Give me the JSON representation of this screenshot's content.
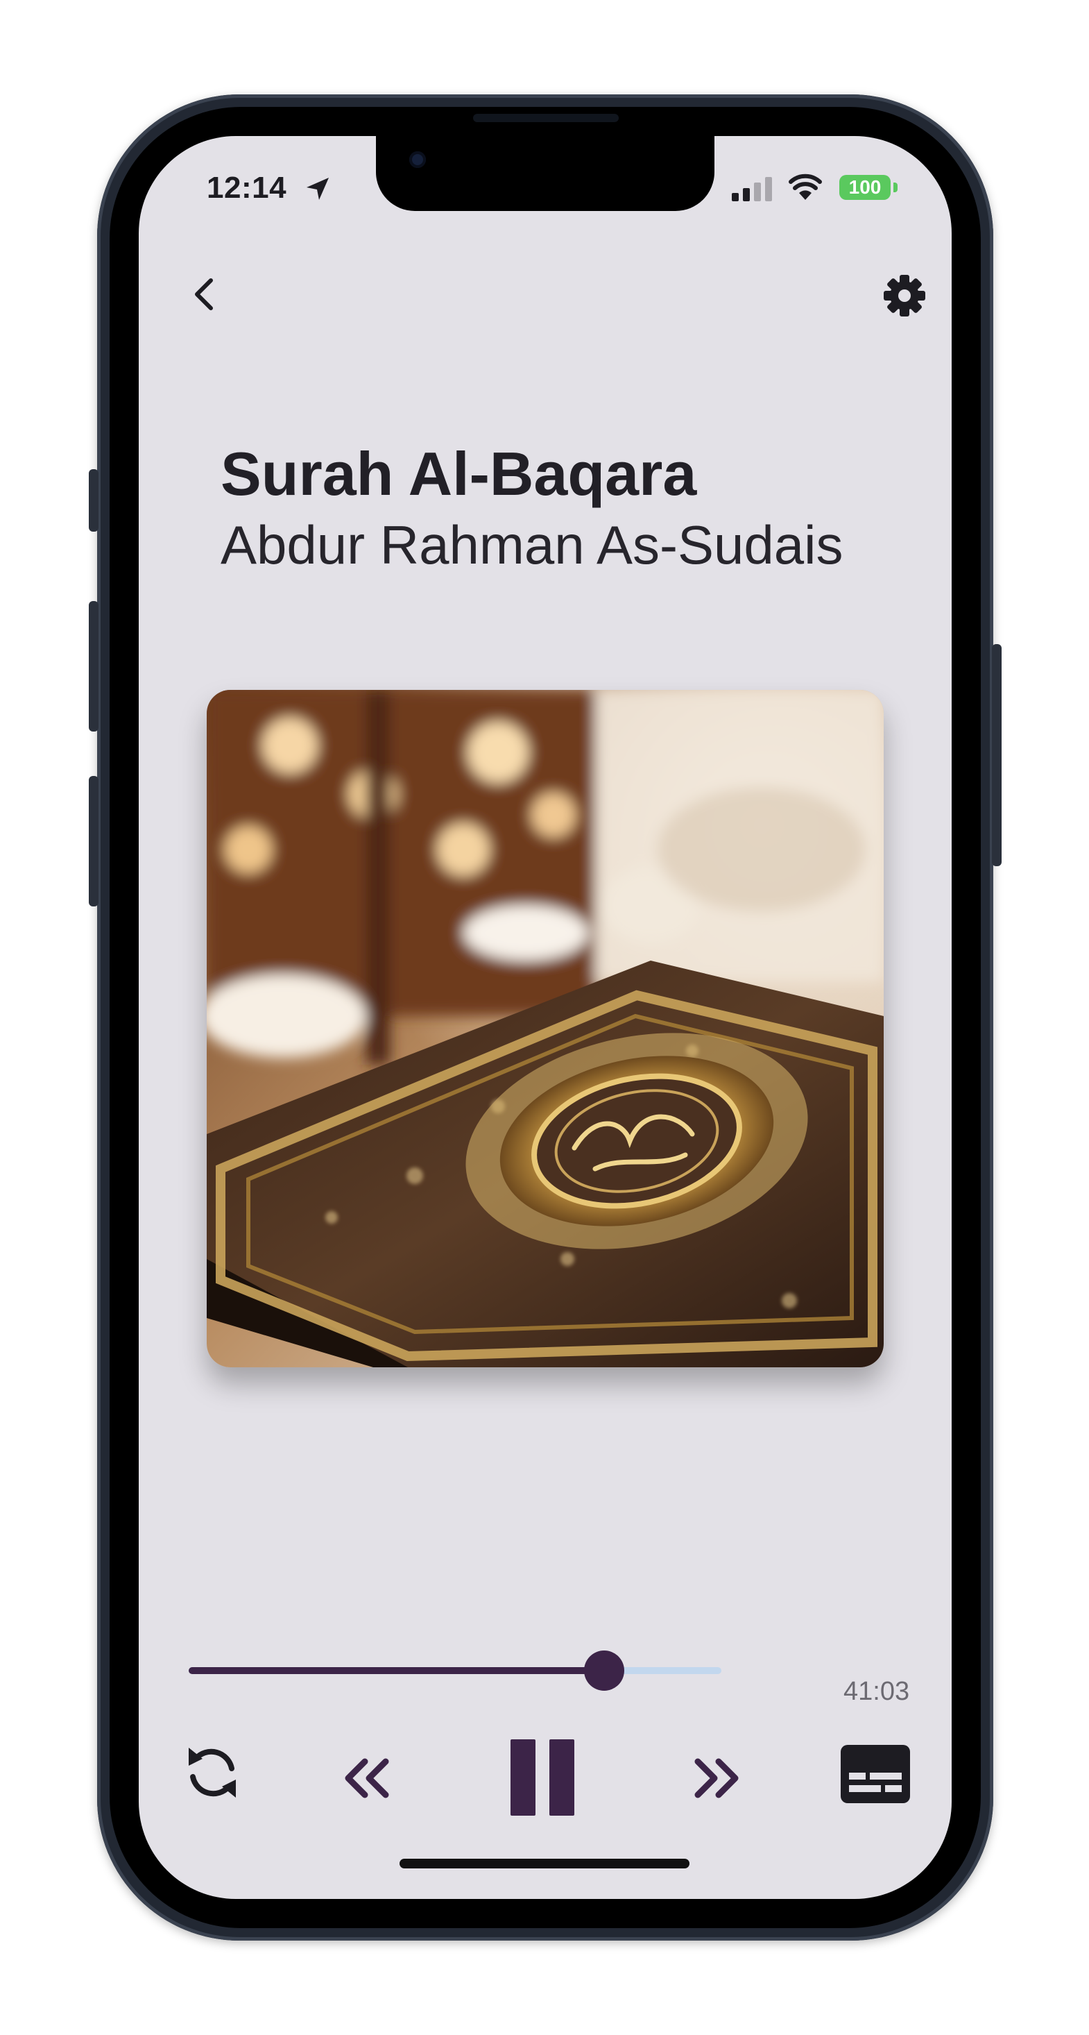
{
  "status_bar": {
    "time": "12:14",
    "battery": "100",
    "icons": [
      "location-arrow-icon",
      "signal-icon",
      "wifi-icon",
      "battery-icon"
    ]
  },
  "header": {
    "back_icon": "chevron-left-icon",
    "settings_icon": "gear-icon"
  },
  "track": {
    "title": "Surah Al-Baqara",
    "reciter": "Abdur Rahman As-Sudais"
  },
  "artwork": {
    "description_icon": "quran-book-image"
  },
  "player": {
    "elapsed": "41:03",
    "progress_fraction": 0.78,
    "buffered_fraction": 1.0,
    "state": "playing"
  },
  "controls": {
    "repeat_icon": "repeat-icon",
    "rewind_icon": "double-chevron-left-icon",
    "pause_icon": "pause-icon",
    "forward_icon": "double-chevron-right-icon",
    "subtitles_icon": "subtitles-icon"
  },
  "colors": {
    "background": "#e3e1e7",
    "accent": "#3c2448",
    "buffer": "#c2d7ee",
    "text": "#222027",
    "battery": "#5ac95e"
  }
}
